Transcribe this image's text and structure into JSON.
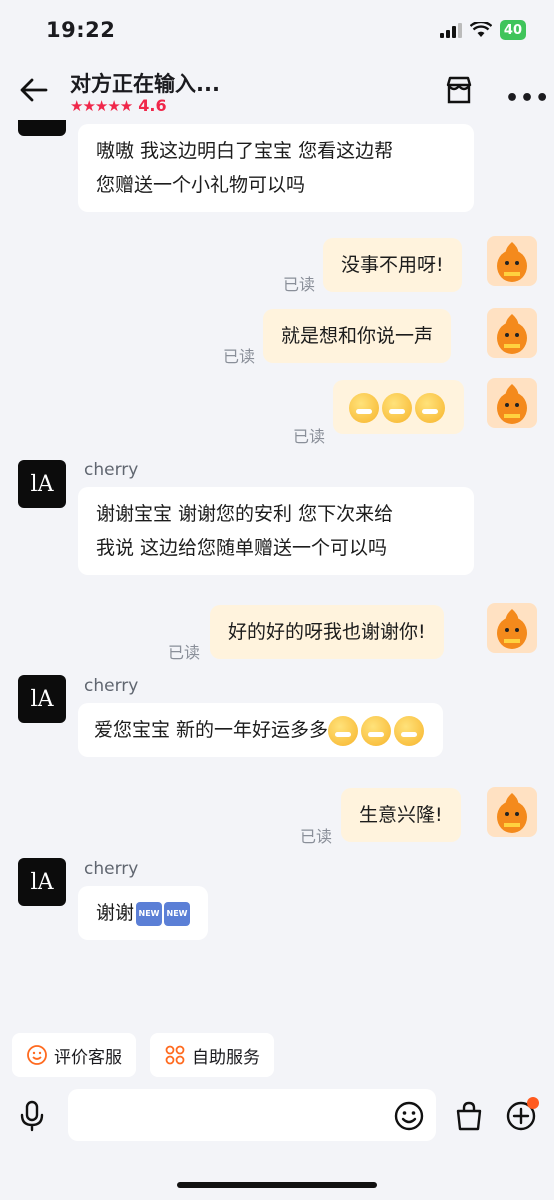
{
  "status": {
    "time": "19:22",
    "battery": "40"
  },
  "header": {
    "title": "对方正在输入...",
    "stars": "★★★★★",
    "rating": "4.6"
  },
  "messages": [
    {
      "from": "agent",
      "lines": [
        "嗷嗷 我这边明白了宝宝 您看这边帮",
        "您赠送一个小礼物可以吗"
      ]
    },
    {
      "from": "me",
      "text": "没事不用呀!",
      "status": "已读"
    },
    {
      "from": "me",
      "text": "就是想和你说一声",
      "status": "已读"
    },
    {
      "from": "me",
      "emoji": [
        "face-with-medical-mask",
        "face-with-medical-mask",
        "face-with-medical-mask"
      ],
      "status": "已读"
    },
    {
      "from": "agent",
      "name": "cherry",
      "lines": [
        "谢谢宝宝 谢谢您的安利 您下次来给",
        "我说 这边给您随单赠送一个可以吗"
      ]
    },
    {
      "from": "me",
      "text": "好的好的呀我也谢谢你!",
      "status": "已读"
    },
    {
      "from": "agent",
      "name": "cherry",
      "text": "爱您宝宝 新的一年好运多多",
      "emoji": [
        "angel-face",
        "angel-face",
        "kissing-face"
      ]
    },
    {
      "from": "me",
      "text": "生意兴隆!",
      "status": "已读"
    },
    {
      "from": "agent",
      "name": "cherry",
      "text": "谢谢",
      "badges": [
        "NEW",
        "NEW"
      ]
    }
  ],
  "agent_avatar": "lA",
  "quick_actions": [
    {
      "label": "评价客服",
      "icon": "smile-icon"
    },
    {
      "label": "自助服务",
      "icon": "grid-icon"
    }
  ],
  "input": {
    "placeholder": ""
  },
  "colors": {
    "rating": "#f0274a",
    "my_bubble": "#fff3dd",
    "accent": "#ff5a1f"
  }
}
